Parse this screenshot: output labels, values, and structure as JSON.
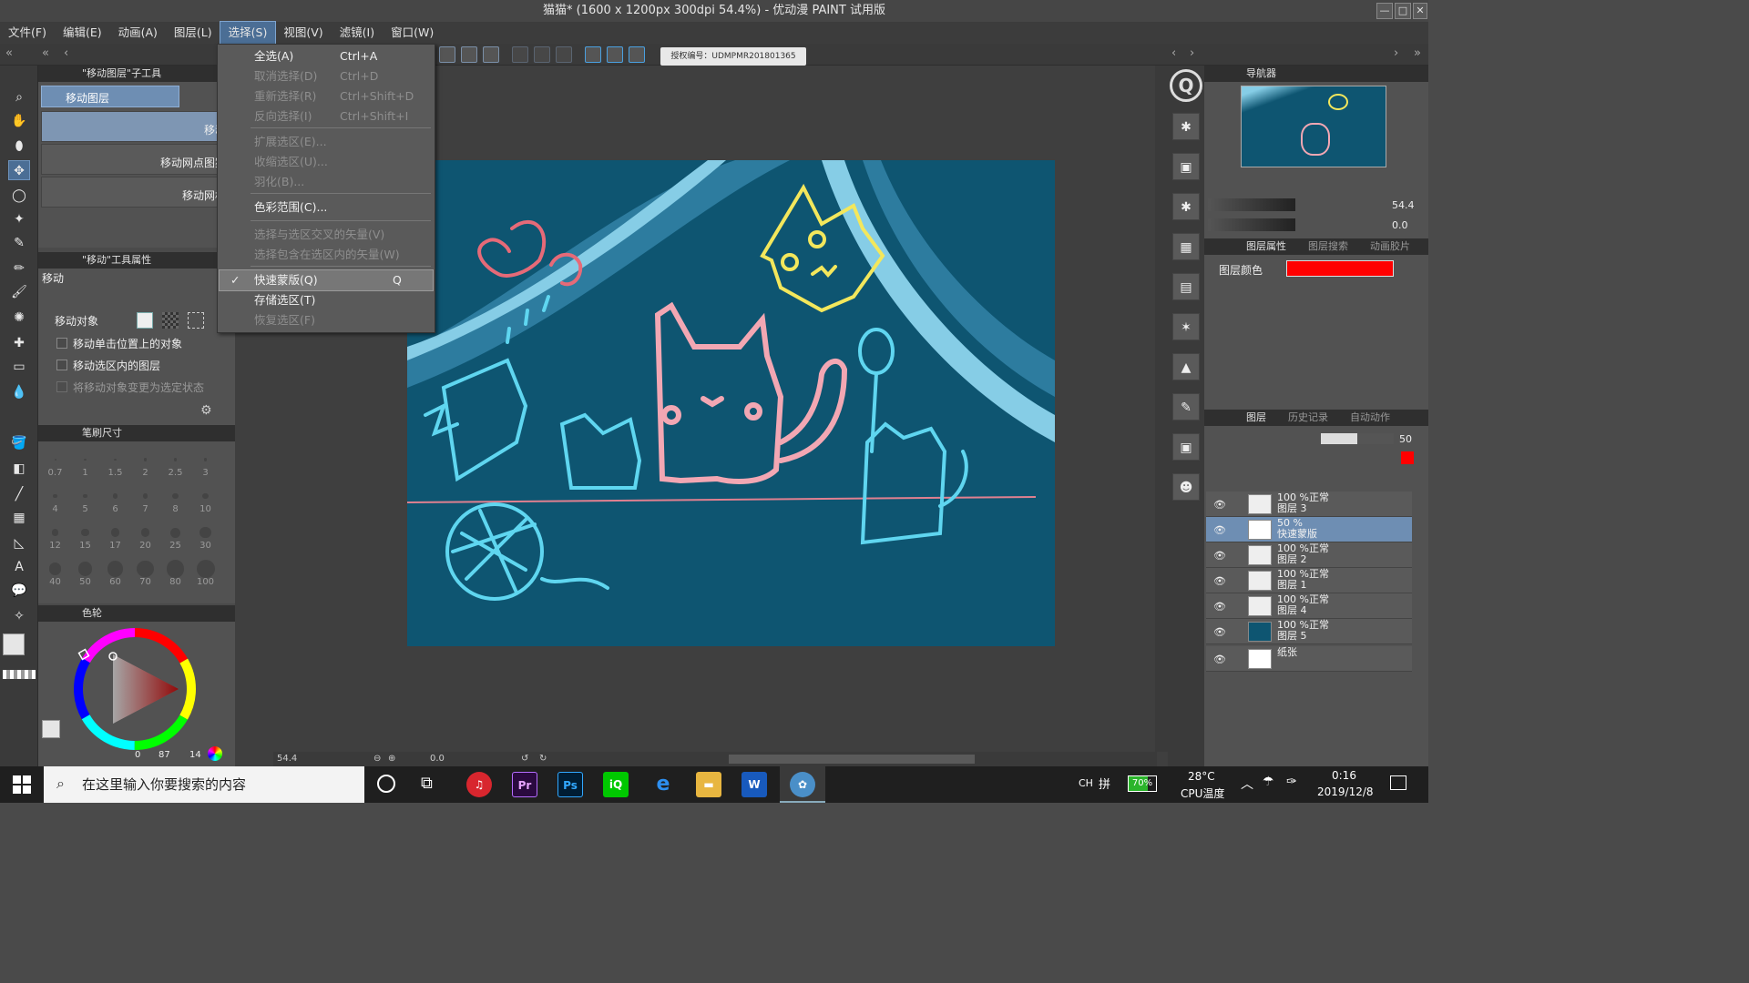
{
  "window": {
    "title": "猫猫* (1600 x 1200px 300dpi 54.4%)  - 优动漫 PAINT 试用版"
  },
  "menu": [
    "文件(F)",
    "编辑(E)",
    "动画(A)",
    "图层(L)",
    "选择(S)",
    "视图(V)",
    "滤镜(I)",
    "窗口(W)"
  ],
  "toolbar": {
    "license": "授权编号：UDMPMR201801365"
  },
  "subtool": {
    "title": "\"移动图层\"子工具",
    "tab": "移动图层",
    "items": [
      "移动",
      "移动网点图案",
      "移动网格"
    ]
  },
  "tool_property": {
    "title": "\"移动\"工具属性",
    "name": "移动",
    "move_target_label": "移动对象",
    "options": [
      "移动单击位置上的对象",
      "移动选区内的图层",
      "将移动对象变更为选定状态"
    ]
  },
  "brush_size": {
    "title": "笔刷尺寸",
    "sizes": [
      "0.7",
      "1",
      "1.5",
      "2",
      "2.5",
      "3",
      "4",
      "5",
      "6",
      "7",
      "8",
      "10",
      "12",
      "15",
      "17",
      "20",
      "25",
      "30",
      "40",
      "50",
      "60",
      "70",
      "80",
      "100"
    ]
  },
  "color_wheel": {
    "title": "色轮",
    "readout_h": "0",
    "readout_s": "87",
    "readout_v": "14"
  },
  "select_menu": {
    "items": [
      {
        "label": "全选(A)",
        "shortcut": "Ctrl+A",
        "enabled": true
      },
      {
        "label": "取消选择(D)",
        "shortcut": "Ctrl+D",
        "enabled": false
      },
      {
        "label": "重新选择(R)",
        "shortcut": "Ctrl+Shift+D",
        "enabled": false
      },
      {
        "label": "反向选择(I)",
        "shortcut": "Ctrl+Shift+I",
        "enabled": false
      },
      {
        "label": "扩展选区(E)...",
        "shortcut": "",
        "enabled": false
      },
      {
        "label": "收缩选区(U)...",
        "shortcut": "",
        "enabled": false
      },
      {
        "label": "羽化(B)...",
        "shortcut": "",
        "enabled": false
      },
      {
        "label": "色彩范围(C)...",
        "shortcut": "",
        "enabled": true
      },
      {
        "label": "选择与选区交叉的矢量(V)",
        "shortcut": "",
        "enabled": false
      },
      {
        "label": "选择包含在选区内的矢量(W)",
        "shortcut": "",
        "enabled": false
      },
      {
        "label": "快速蒙版(Q)",
        "shortcut": "Q",
        "enabled": true,
        "checked": true
      },
      {
        "label": "存储选区(T)",
        "shortcut": "",
        "enabled": true
      },
      {
        "label": "恢复选区(F)",
        "shortcut": "",
        "enabled": false
      }
    ]
  },
  "navigator": {
    "tabs": [
      "导航器"
    ],
    "zoom": "54.4",
    "rotation": "0.0"
  },
  "layer_property": {
    "tabs": [
      "图层属性",
      "图层搜索",
      "动画胶片"
    ],
    "color_label": "图层颜色",
    "color": "#ff0000"
  },
  "layers": {
    "tabs": [
      "图层",
      "历史记录",
      "自动动作"
    ],
    "opacity": "50",
    "rows": [
      {
        "opacity": "100 %正常",
        "name": "图层 3"
      },
      {
        "opacity": "50 %",
        "name": "快速蒙版"
      },
      {
        "opacity": "100 %正常",
        "name": "图层 2"
      },
      {
        "opacity": "100 %正常",
        "name": "图层 1"
      },
      {
        "opacity": "100 %正常",
        "name": "图层 4"
      },
      {
        "opacity": "100 %正常",
        "name": "图层 5"
      },
      {
        "opacity": "",
        "name": "纸张"
      }
    ]
  },
  "status": {
    "zoom": "54.4",
    "angle": "0.0"
  },
  "taskbar": {
    "search_placeholder": "在这里输入你要搜索的内容",
    "ime": "CH",
    "battery": "70%",
    "temp": "28°C",
    "temp_label": "CPU温度",
    "time": "0:16",
    "date": "2019/12/8"
  },
  "colors": {
    "accent": "#4b6e95",
    "artboard": "#0e5571",
    "pink": "#f2a7b3",
    "yellow": "#f3e75c",
    "cyan": "#5fd6f0"
  }
}
